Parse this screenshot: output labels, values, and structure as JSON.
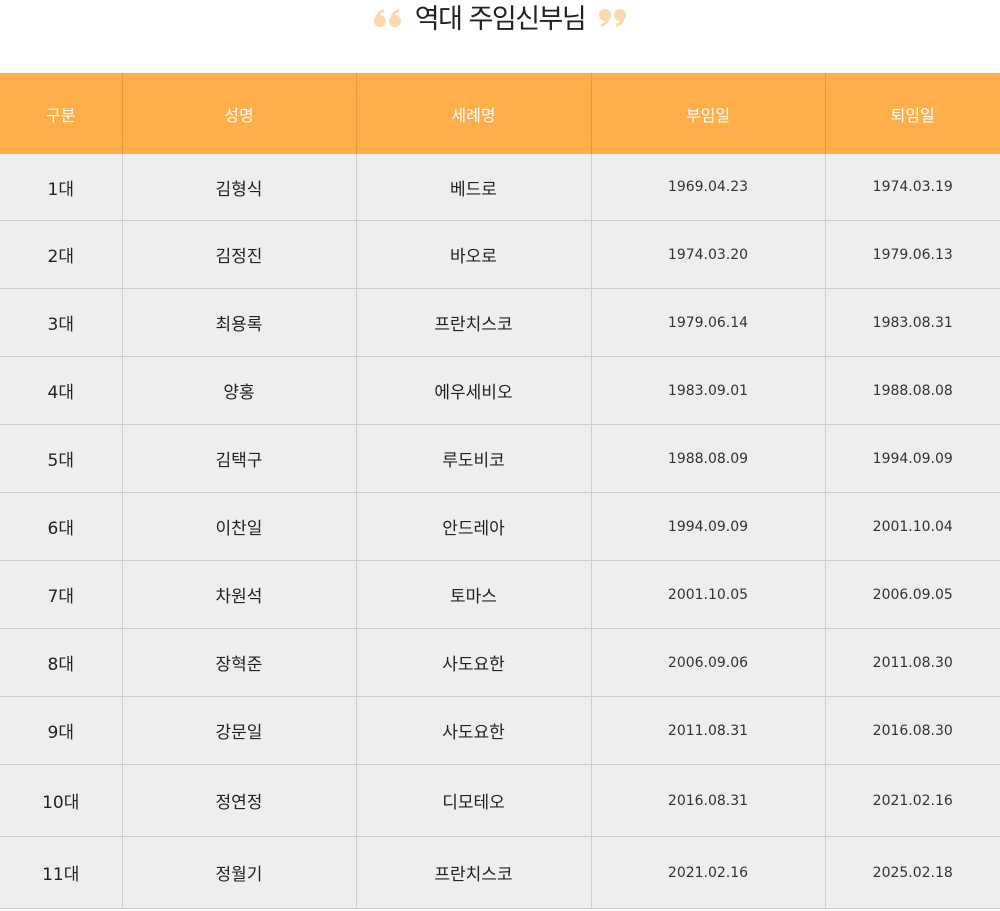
{
  "title": "역대 주임신부님",
  "colors": {
    "header_bg": "#ffae4a",
    "quote": "#fbd9ae",
    "row_bg": "#eeeeee"
  },
  "table": {
    "headers": [
      "구분",
      "성명",
      "세례명",
      "부임일",
      "퇴임일"
    ],
    "rows": [
      [
        "1대",
        "김형식",
        "베드로",
        "1969.04.23",
        "1974.03.19"
      ],
      [
        "2대",
        "김정진",
        "바오로",
        "1974.03.20",
        "1979.06.13"
      ],
      [
        "3대",
        "최용록",
        "프란치스코",
        "1979.06.14",
        "1983.08.31"
      ],
      [
        "4대",
        "양홍",
        "에우세비오",
        "1983.09.01",
        "1988.08.08"
      ],
      [
        "5대",
        "김택구",
        "루도비코",
        "1988.08.09",
        "1994.09.09"
      ],
      [
        "6대",
        "이찬일",
        "안드레아",
        "1994.09.09",
        "2001.10.04"
      ],
      [
        "7대",
        "차원석",
        "토마스",
        "2001.10.05",
        "2006.09.05"
      ],
      [
        "8대",
        "장혁준",
        "사도요한",
        "2006.09.06",
        "2011.08.30"
      ],
      [
        "9대",
        "강문일",
        "사도요한",
        "2011.08.31",
        "2016.08.30"
      ],
      [
        "10대",
        "정연정",
        "디모테오",
        "2016.08.31",
        "2021.02.16"
      ],
      [
        "11대",
        "정월기",
        "프란치스코",
        "2021.02.16",
        "2025.02.18"
      ]
    ]
  }
}
